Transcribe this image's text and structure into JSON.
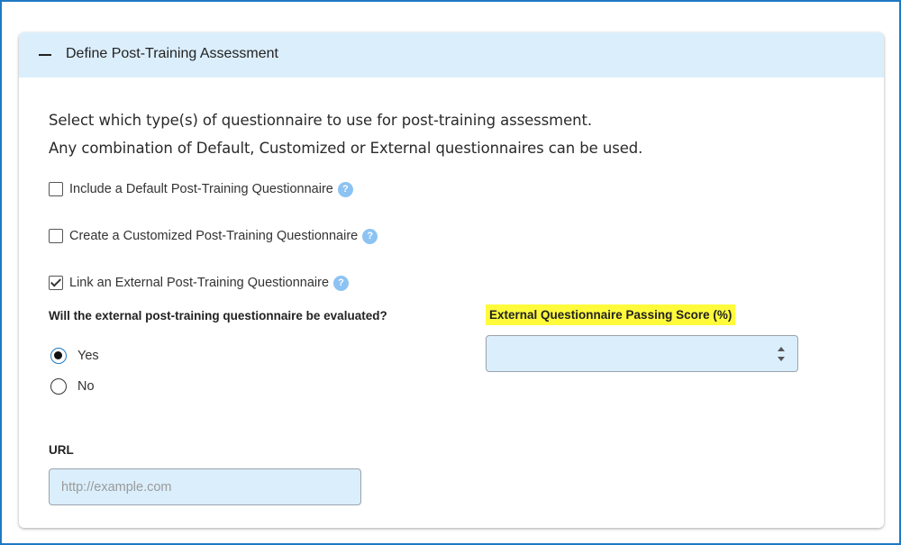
{
  "panel": {
    "title": "Define Post-Training Assessment",
    "intro_line1": "Select which type(s) of questionnaire to use for post-training assessment.",
    "intro_line2": "Any combination of Default, Customized or External questionnaires can be used."
  },
  "options": [
    {
      "label": "Include a Default Post-Training Questionnaire",
      "checked": false
    },
    {
      "label": "Create a Customized Post-Training Questionnaire",
      "checked": false
    },
    {
      "label": "Link an External Post-Training Questionnaire",
      "checked": true
    }
  ],
  "help_glyph": "?",
  "evaluation": {
    "question": "Will the external post-training questionnaire be evaluated?",
    "yes_label": "Yes",
    "no_label": "No",
    "selected": "Yes"
  },
  "passing_score": {
    "label": "External Questionnaire Passing Score (%)",
    "value": ""
  },
  "url": {
    "label": "URL",
    "placeholder": "http://example.com",
    "value": ""
  },
  "colors": {
    "frame_border": "#1f79c2",
    "header_bg": "#dbeefc",
    "input_bg": "#dbeefc",
    "help_icon": "#8cc3f2",
    "highlight": "#fffb3b"
  }
}
